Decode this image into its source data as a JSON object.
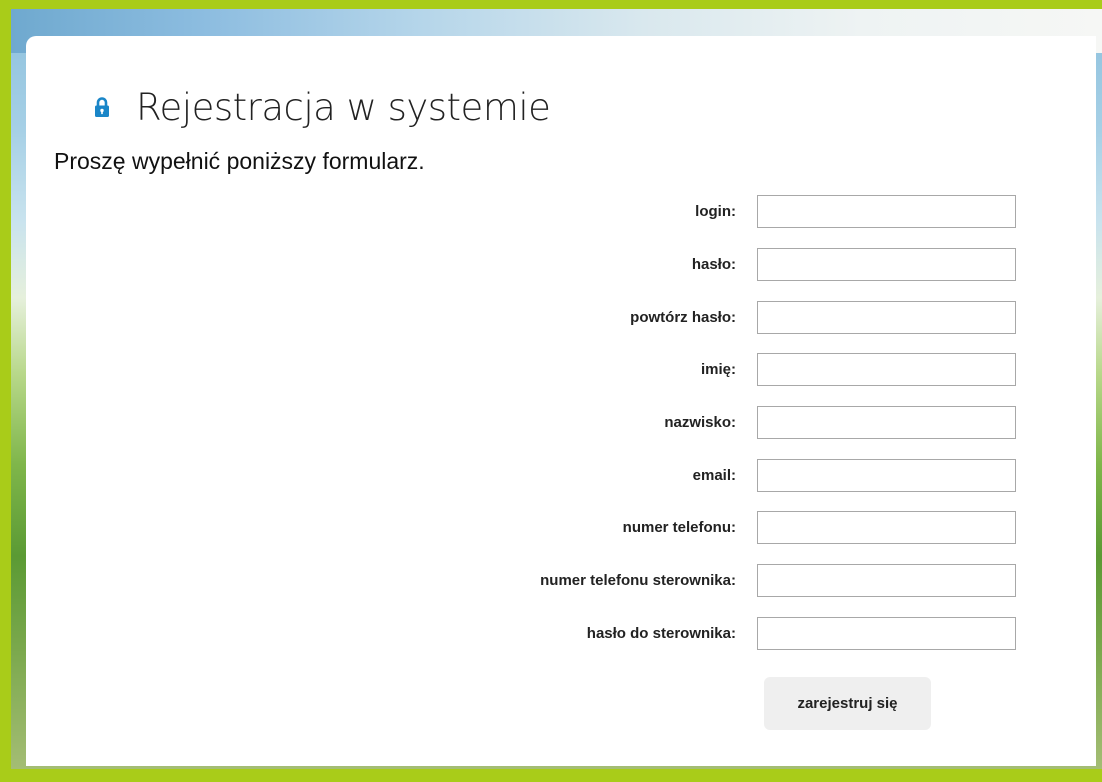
{
  "header": {
    "lock_icon": "lock-icon",
    "title": "Rejestracja w systemie",
    "subtitle": "Proszę wypełnić poniższy formularz."
  },
  "form": {
    "fields": [
      {
        "name": "login",
        "label": "login:",
        "value": ""
      },
      {
        "name": "password",
        "label": "hasło:",
        "value": ""
      },
      {
        "name": "repeat-password",
        "label": "powtórz hasło:",
        "value": ""
      },
      {
        "name": "first-name",
        "label": "imię:",
        "value": ""
      },
      {
        "name": "last-name",
        "label": "nazwisko:",
        "value": ""
      },
      {
        "name": "email",
        "label": "email:",
        "value": ""
      },
      {
        "name": "phone",
        "label": "numer telefonu:",
        "value": ""
      },
      {
        "name": "controller-phone",
        "label": "numer telefonu sterownika:",
        "value": ""
      },
      {
        "name": "controller-password",
        "label": "hasło do sterownika:",
        "value": ""
      }
    ],
    "submit_label": "zarejestruj się"
  },
  "colors": {
    "frame_border": "#a9cc19",
    "lock_icon": "#1a86c8",
    "panel_background": "#ffffff"
  }
}
